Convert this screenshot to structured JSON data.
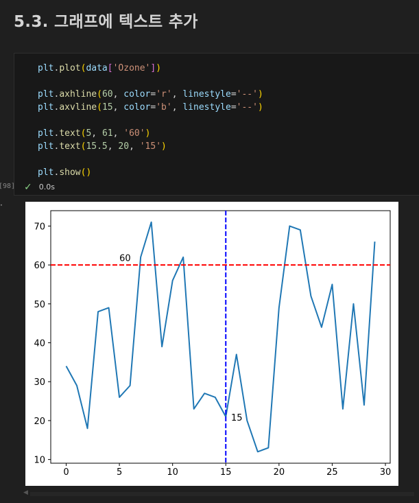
{
  "heading": "5.3. 그래프에 텍스트 추가",
  "cell": {
    "execution_count": "[98]",
    "status_time": "0.0s",
    "code_lines": [
      [
        {
          "t": "plt",
          "c": "nm"
        },
        {
          "t": ".",
          "c": "pn"
        },
        {
          "t": "plot",
          "c": "fn"
        },
        {
          "t": "(",
          "c": "br"
        },
        {
          "t": "data",
          "c": "nm"
        },
        {
          "t": "[",
          "c": "br2"
        },
        {
          "t": "'Ozone'",
          "c": "st"
        },
        {
          "t": "]",
          "c": "br2"
        },
        {
          "t": ")",
          "c": "br"
        }
      ],
      [],
      [
        {
          "t": "plt",
          "c": "nm"
        },
        {
          "t": ".",
          "c": "pn"
        },
        {
          "t": "axhline",
          "c": "fn"
        },
        {
          "t": "(",
          "c": "br"
        },
        {
          "t": "60",
          "c": "nu"
        },
        {
          "t": ", ",
          "c": "pn"
        },
        {
          "t": "color",
          "c": "nm"
        },
        {
          "t": "=",
          "c": "op"
        },
        {
          "t": "'r'",
          "c": "st"
        },
        {
          "t": ", ",
          "c": "pn"
        },
        {
          "t": "linestyle",
          "c": "nm"
        },
        {
          "t": "=",
          "c": "op"
        },
        {
          "t": "'--'",
          "c": "st"
        },
        {
          "t": ")",
          "c": "br"
        }
      ],
      [
        {
          "t": "plt",
          "c": "nm"
        },
        {
          "t": ".",
          "c": "pn"
        },
        {
          "t": "axvline",
          "c": "fn"
        },
        {
          "t": "(",
          "c": "br"
        },
        {
          "t": "15",
          "c": "nu"
        },
        {
          "t": ", ",
          "c": "pn"
        },
        {
          "t": "color",
          "c": "nm"
        },
        {
          "t": "=",
          "c": "op"
        },
        {
          "t": "'b'",
          "c": "st"
        },
        {
          "t": ", ",
          "c": "pn"
        },
        {
          "t": "linestyle",
          "c": "nm"
        },
        {
          "t": "=",
          "c": "op"
        },
        {
          "t": "'--'",
          "c": "st"
        },
        {
          "t": ")",
          "c": "br"
        }
      ],
      [],
      [
        {
          "t": "plt",
          "c": "nm"
        },
        {
          "t": ".",
          "c": "pn"
        },
        {
          "t": "text",
          "c": "fn"
        },
        {
          "t": "(",
          "c": "br"
        },
        {
          "t": "5",
          "c": "nu"
        },
        {
          "t": ", ",
          "c": "pn"
        },
        {
          "t": "61",
          "c": "nu"
        },
        {
          "t": ", ",
          "c": "pn"
        },
        {
          "t": "'60'",
          "c": "st"
        },
        {
          "t": ")",
          "c": "br"
        }
      ],
      [
        {
          "t": "plt",
          "c": "nm"
        },
        {
          "t": ".",
          "c": "pn"
        },
        {
          "t": "text",
          "c": "fn"
        },
        {
          "t": "(",
          "c": "br"
        },
        {
          "t": "15.5",
          "c": "nu"
        },
        {
          "t": ", ",
          "c": "pn"
        },
        {
          "t": "20",
          "c": "nu"
        },
        {
          "t": ", ",
          "c": "pn"
        },
        {
          "t": "'15'",
          "c": "st"
        },
        {
          "t": ")",
          "c": "br"
        }
      ],
      [],
      [
        {
          "t": "plt",
          "c": "nm"
        },
        {
          "t": ".",
          "c": "pn"
        },
        {
          "t": "show",
          "c": "fn"
        },
        {
          "t": "(",
          "c": "br"
        },
        {
          "t": ")",
          "c": "br"
        }
      ]
    ]
  },
  "chart_data": {
    "type": "line",
    "x": [
      0,
      1,
      2,
      3,
      4,
      5,
      6,
      7,
      8,
      9,
      10,
      11,
      12,
      13,
      14,
      15,
      16,
      17,
      18,
      19,
      20,
      21,
      22,
      23,
      24,
      25,
      26,
      27,
      28,
      29
    ],
    "series": [
      {
        "values": [
          34,
          29,
          18,
          48,
          49,
          26,
          29,
          62,
          71,
          39,
          56,
          62,
          23,
          27,
          26,
          21,
          37,
          20,
          12,
          13,
          49,
          70,
          69,
          52,
          44,
          55,
          23,
          50,
          24,
          66
        ],
        "color": "#1f77b4"
      }
    ],
    "xlim": [
      -1.45,
      30.45
    ],
    "ylim": [
      9.05,
      73.95
    ],
    "xticks": [
      0,
      5,
      10,
      15,
      20,
      25,
      30
    ],
    "yticks": [
      10,
      20,
      30,
      40,
      50,
      60,
      70
    ],
    "axhline": {
      "y": 60,
      "color": "#ff0000"
    },
    "axvline": {
      "x": 15,
      "color": "#0000ff"
    },
    "annotations": [
      {
        "x": 5,
        "y": 61,
        "text": "60"
      },
      {
        "x": 15.5,
        "y": 20,
        "text": "15"
      }
    ]
  }
}
